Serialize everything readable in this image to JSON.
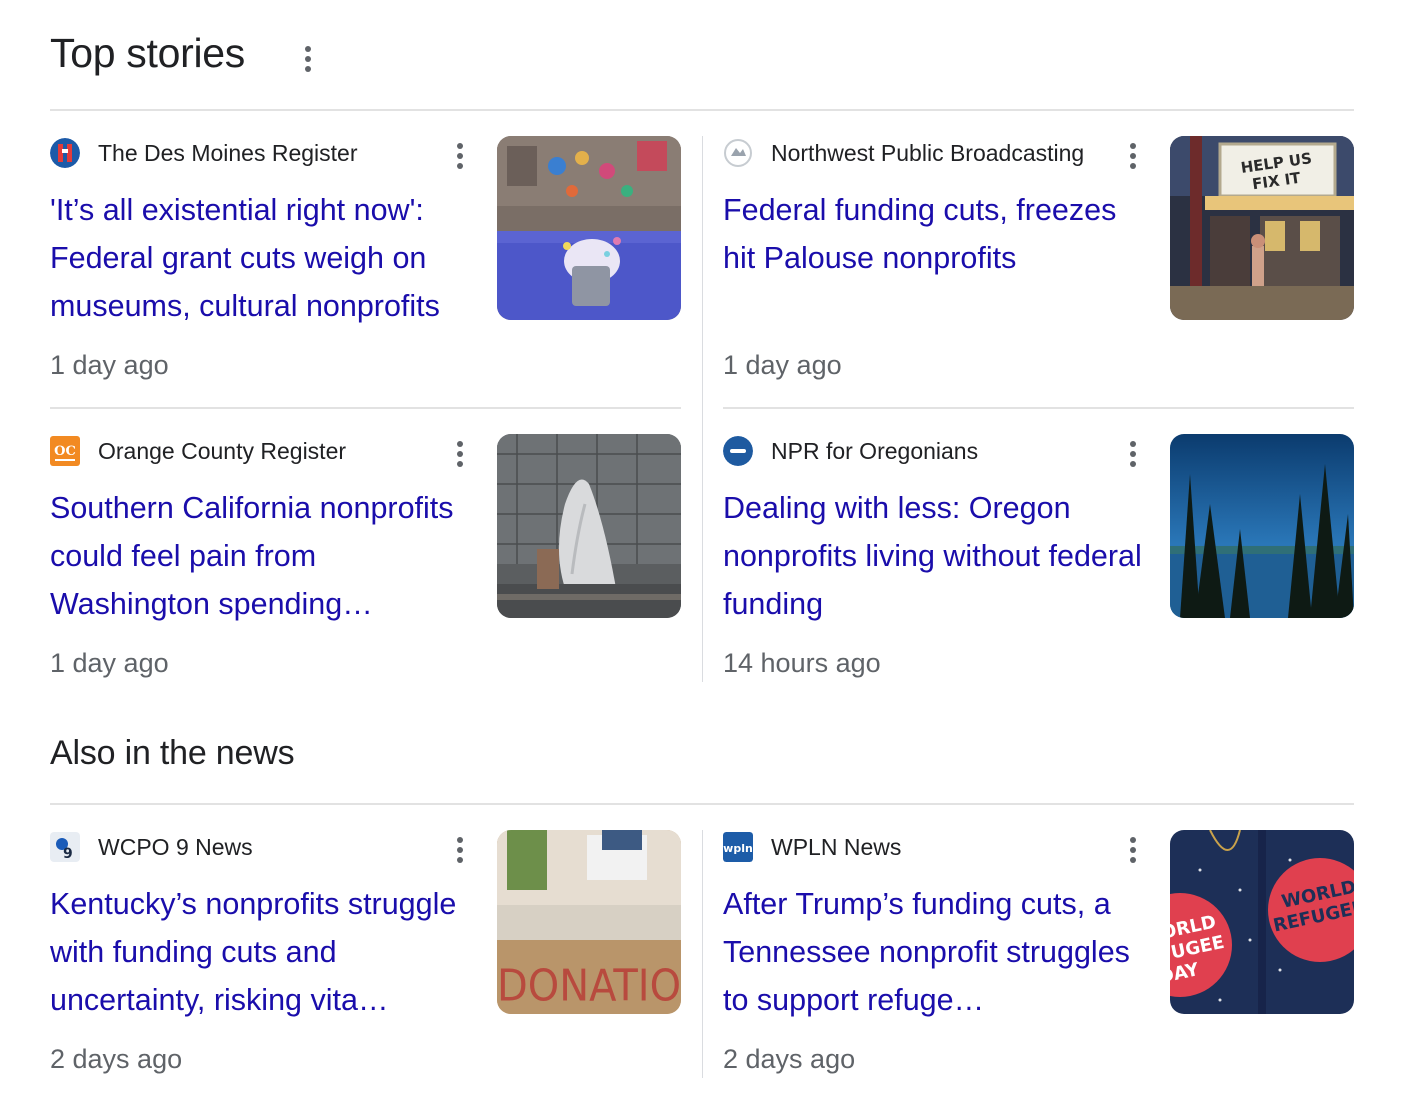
{
  "top_stories": {
    "title": "Top stories",
    "items": [
      {
        "source": "The Des Moines Register",
        "favicon": "des-moines-register-logo",
        "headline": "'It’s all existential right now': Federal grant cuts weigh on museums, cultural nonprofits",
        "time": "1 day ago"
      },
      {
        "source": "Northwest Public Broadcasting",
        "favicon": "nwpb-logo",
        "headline": "Federal funding cuts, freezes hit Palouse nonprofits",
        "time": "1 day ago",
        "thumb_text": "HELP US FIX IT"
      },
      {
        "source": "Orange County Register",
        "favicon": "ocr-logo",
        "headline": "Southern California nonprofits could feel pain from Washington spending…",
        "time": "1 day ago"
      },
      {
        "source": "NPR for Oregonians",
        "favicon": "opb-logo",
        "headline": "Dealing with less: Oregon nonprofits living without federal funding",
        "time": "14 hours ago"
      }
    ]
  },
  "also_in_news": {
    "title": "Also in the news",
    "items": [
      {
        "source": "WCPO 9 News",
        "favicon": "wcpo-logo",
        "headline": "Kentucky’s nonprofits struggle with funding cuts and uncertainty, risking vita…",
        "time": "2 days ago",
        "thumb_text": "DONATIO"
      },
      {
        "source": "WPLN News",
        "favicon": "wpln-logo",
        "headline": "After Trump’s funding cuts, a Tennessee nonprofit struggles to support refuge…",
        "time": "2 days ago",
        "thumb_text": "WORLD REFUGEE DAY"
      }
    ]
  },
  "colors": {
    "link": "#1a0dab",
    "text": "#202124",
    "meta": "#5f6368",
    "divider": "#e2e2e2"
  }
}
